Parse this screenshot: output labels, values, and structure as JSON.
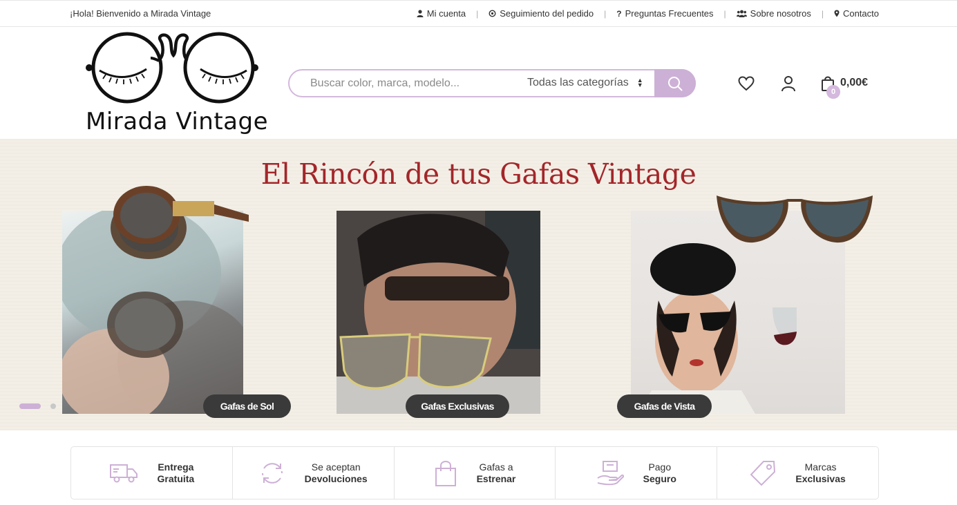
{
  "topbar": {
    "welcome": "¡Hola! Bienvenido a Mirada Vintage",
    "links": [
      {
        "label": "Mi cuenta",
        "icon": "user-icon"
      },
      {
        "label": "Seguimiento del pedido",
        "icon": "target-icon"
      },
      {
        "label": "Preguntas Frecuentes",
        "icon": "question-icon"
      },
      {
        "label": "Sobre nosotros",
        "icon": "group-icon"
      },
      {
        "label": "Contacto",
        "icon": "map-pin-icon"
      }
    ]
  },
  "header": {
    "logo_text": "Mirada Vintage",
    "search_placeholder": "Buscar color, marca, modelo...",
    "category_selected": "Todas las categorías",
    "cart_total": "0,00€",
    "cart_count": "0"
  },
  "hero": {
    "title": "El Rincón de tus Gafas Vintage",
    "slides": [
      {
        "label": "Gafas de Sol"
      },
      {
        "label": "Gafas Exclusivas"
      },
      {
        "label": "Gafas de Vista"
      }
    ]
  },
  "features": [
    {
      "line1": "Entrega",
      "line2": "Gratuita",
      "bold_first": true,
      "icon": "delivery-truck-icon"
    },
    {
      "line1": "Se aceptan",
      "line2": "Devoluciones",
      "bold_first": false,
      "icon": "returns-icon"
    },
    {
      "line1": "Gafas a",
      "line2": "Estrenar",
      "bold_first": false,
      "icon": "shopping-bag-icon"
    },
    {
      "line1": "Pago",
      "line2": "Seguro",
      "bold_first": false,
      "icon": "secure-payment-icon"
    },
    {
      "line1": "Marcas",
      "line2": "Exclusivas",
      "bold_first": false,
      "icon": "price-tag-icon"
    }
  ],
  "colors": {
    "accent": "#cdb0d6",
    "title_red": "#a3262a",
    "tag_bg": "#3a3a3a"
  }
}
